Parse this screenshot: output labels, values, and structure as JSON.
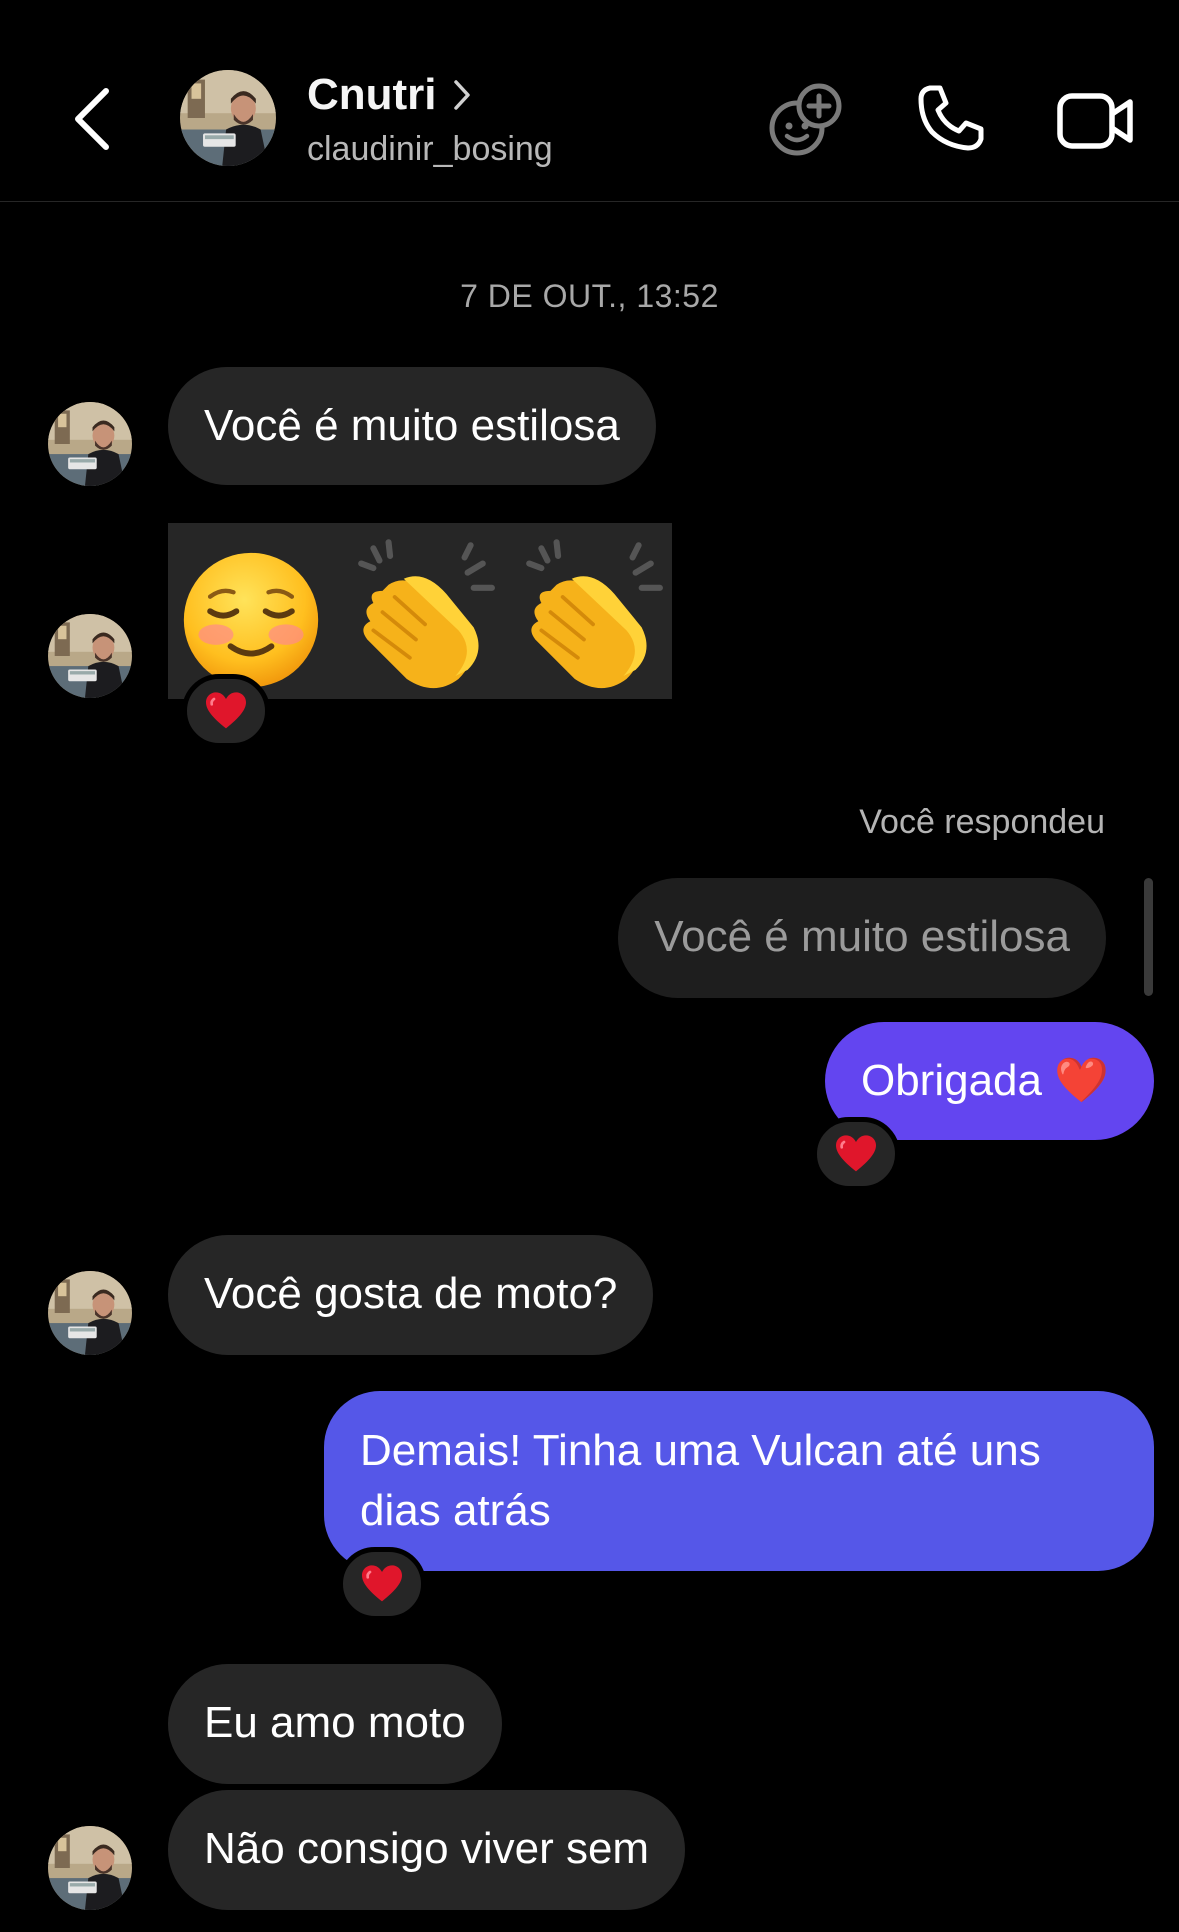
{
  "header": {
    "name": "Cnutri",
    "username": "claudinir_bosing",
    "icons": [
      "back-chevron-icon",
      "add-friend-group-icon",
      "phone-icon",
      "video-camera-icon"
    ]
  },
  "timestamp": "7 DE OUT., 13:52",
  "messages": [
    {
      "from": "them",
      "text": "Você é muito estilosa"
    },
    {
      "from": "them",
      "type": "emoji",
      "text": "☺️👏👏",
      "reaction": "❤️"
    },
    {
      "from": "me",
      "reply_label": "Você respondeu",
      "quoted": "Você é muito estilosa"
    },
    {
      "from": "me",
      "text": "Obrigada ❤️",
      "reaction": "❤️"
    },
    {
      "from": "them",
      "text": "Você gosta de moto?"
    },
    {
      "from": "me",
      "text": "Demais! Tinha uma Vulcan até uns dias atrás",
      "reaction": "❤️"
    },
    {
      "from": "them",
      "text": "Eu amo moto"
    },
    {
      "from": "them",
      "text": "Não consigo viver sem"
    }
  ],
  "colors": {
    "background": "#000000",
    "incoming_bubble": "#262626",
    "outgoing_purple": "#6345f0",
    "outgoing_blue": "#5557e8",
    "reaction_heart": "#e0162b"
  }
}
